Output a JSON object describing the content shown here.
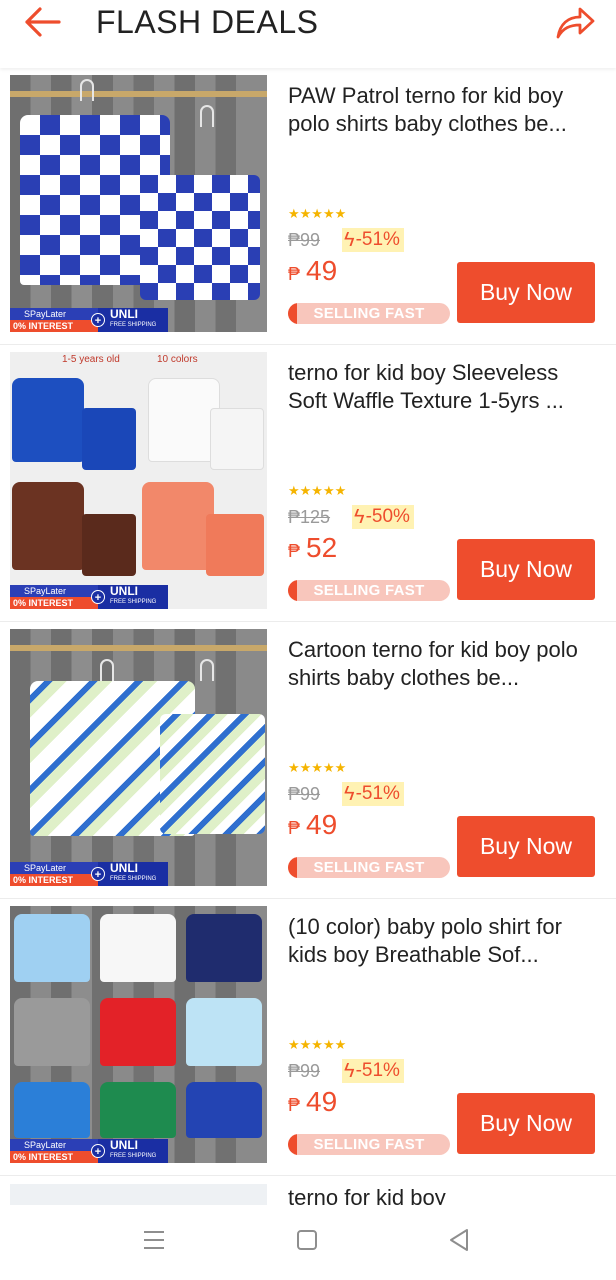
{
  "header": {
    "title": "FLASH DEALS",
    "back_icon": "back-arrow-icon",
    "share_icon": "share-icon",
    "accent": "#ee4d2d"
  },
  "badges": {
    "spaylater": "SPayLater",
    "interest": "0% INTEREST",
    "plus": "+",
    "unli": "UNLI",
    "free_shipping": "FREE SHIPPING"
  },
  "products": [
    {
      "name": "PAW Patrol terno for kid boy polo shirts baby clothes be...",
      "stars": "★★★★★",
      "old_price": "₱99",
      "discount": "-51%",
      "currency": "₱",
      "price": "49",
      "selling_label": "SELLING FAST",
      "buy_label": "Buy Now"
    },
    {
      "annot_left": "1-5 years old",
      "annot_right": "10 colors",
      "name": "terno for kid boy Sleeveless Soft Waffle Texture 1-5yrs ...",
      "stars": "★★★★★",
      "old_price": "₱125",
      "discount": "-50%",
      "currency": "₱",
      "price": "52",
      "selling_label": "SELLING FAST",
      "buy_label": "Buy Now"
    },
    {
      "name": "Cartoon terno for kid boy polo shirts baby clothes be...",
      "stars": "★★★★★",
      "old_price": "₱99",
      "discount": "-51%",
      "currency": "₱",
      "price": "49",
      "selling_label": "SELLING FAST",
      "buy_label": "Buy Now"
    },
    {
      "name": "(10 color) baby polo shirt for kids boy Breathable Sof...",
      "stars": "★★★★★",
      "old_price": "₱99",
      "discount": "-51%",
      "currency": "₱",
      "price": "49",
      "selling_label": "SELLING FAST",
      "buy_label": "Buy Now"
    },
    {
      "name": "terno for kid boy"
    }
  ],
  "navbar": {
    "menu_icon": "menu-icon",
    "home_icon": "home-square-icon",
    "back_icon": "back-triangle-icon"
  }
}
